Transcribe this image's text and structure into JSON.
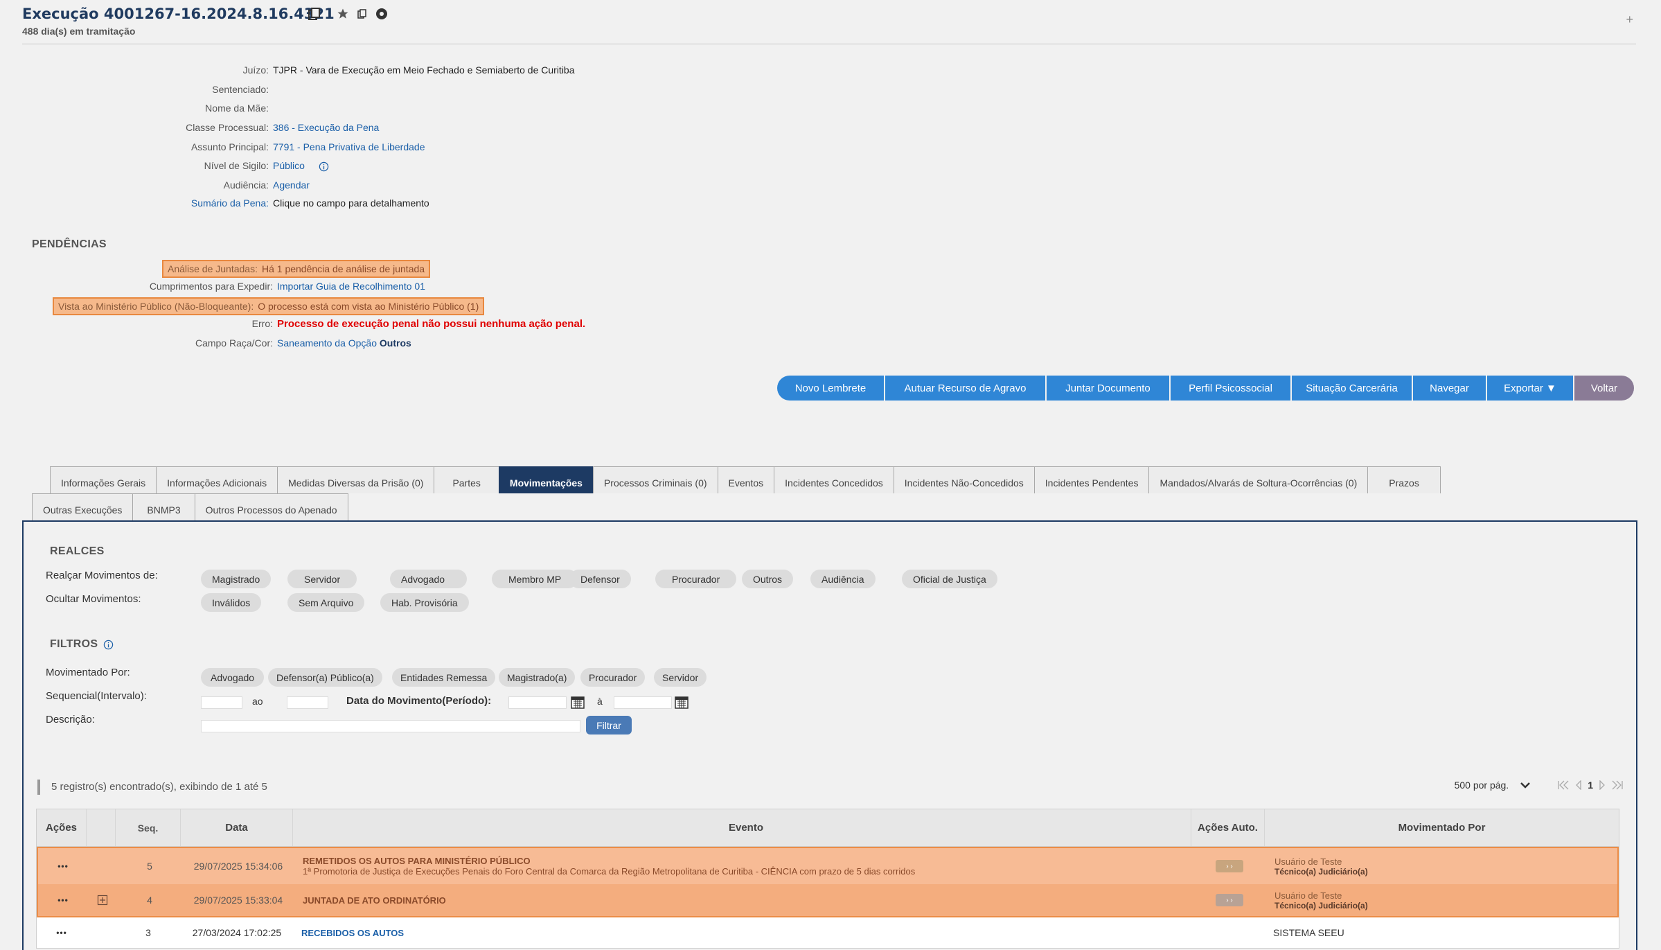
{
  "header": {
    "title": "Execução 4001267-16.2024.8.16.4321",
    "subtitle": "488 dia(s) em tramitação",
    "plus": "+"
  },
  "details": [
    {
      "label": "Juízo:",
      "value": "TJPR - Vara de Execução em Meio Fechado e Semiaberto de Curitiba"
    },
    {
      "label": "Sentenciado:",
      "value": ""
    },
    {
      "label": "Nome da Mãe:",
      "value": ""
    },
    {
      "label": "Classe Processual:",
      "value": "386 - Execução da Pena"
    },
    {
      "label": "Assunto Principal:",
      "value": "7791 - Pena Privativa de Liberdade"
    },
    {
      "label": "Nível de Sigilo:",
      "value": "Público"
    },
    {
      "label": "Audiência:",
      "value": "Agendar"
    },
    {
      "label": "Sumário da Pena:",
      "value": "Clique no campo para detalhamento"
    }
  ],
  "pendencias": {
    "title": "PENDÊNCIAS",
    "rows": [
      {
        "label": "Análise de Juntadas:",
        "value": "Há 1 pendência de análise de juntada"
      },
      {
        "label": "Cumprimentos para Expedir:",
        "value": "Importar Guia de Recolhimento 01"
      },
      {
        "label": "Vista ao Ministério Público (Não-Bloqueante):",
        "value": "O processo está com vista ao Ministério Público (1)"
      },
      {
        "label": "Erro:",
        "value": "Processo de execução penal não possui nenhuma ação penal."
      },
      {
        "label": "Campo Raça/Cor:",
        "value": "Saneamento da Opção ",
        "value_bold": "Outros"
      }
    ]
  },
  "actions": [
    "Novo Lembrete",
    "Autuar Recurso de Agravo",
    "Juntar Documento",
    "Perfil Psicossocial",
    "Situação Carcerária",
    "Navegar",
    "Exportar ▼",
    "Voltar"
  ],
  "tabs_row1": [
    "Informações Gerais",
    "Informações Adicionais",
    "Medidas Diversas da Prisão (0)",
    "Partes",
    "Movimentações",
    "Processos Criminais (0)",
    "Eventos",
    "Incidentes Concedidos",
    "Incidentes Não-Concedidos",
    "Incidentes Pendentes",
    "Mandados/Alvarás de Soltura-Ocorrências (0)",
    "Prazos"
  ],
  "tabs_row2": [
    "Outras Execuções",
    "BNMP3",
    "Outros Processos do Apenado"
  ],
  "realces": {
    "title": "REALCES",
    "realcar_label": "Realçar Movimentos de:",
    "realcar_chips": [
      "Magistrado",
      "Servidor",
      "Advogado",
      "Membro MP",
      "Defensor",
      "Procurador",
      "Outros",
      "Audiência",
      "Oficial de Justiça"
    ],
    "ocultar_label": "Ocultar Movimentos:",
    "ocultar_chips": [
      "Inválidos",
      "Sem Arquivo",
      "Hab. Provisória"
    ]
  },
  "filtros": {
    "title": "FILTROS",
    "mov_por_label": "Movimentado Por:",
    "mov_por_chips": [
      "Advogado",
      "Defensor(a) Público(a)",
      "Entidades Remessa",
      "Magistrado(a)",
      "Procurador",
      "Servidor"
    ],
    "seq_label": "Sequencial(Intervalo):",
    "ao": "ao",
    "data_label": "Data do Movimento(Período):",
    "a": "à",
    "desc_label": "Descrição:",
    "filtrar": "Filtrar"
  },
  "results": {
    "count_text": "5 registro(s) encontrado(s), exibindo de 1 até 5",
    "per_page": "500 por pág.",
    "page": "1"
  },
  "table": {
    "headers": [
      "Ações",
      "",
      "Seq.",
      "Data",
      "Evento",
      "Ações Auto.",
      "Movimentado Por"
    ],
    "rows": [
      {
        "acoes": "•••",
        "seq": "5",
        "data": "29/07/2025 15:34:06",
        "evento": "REMETIDOS OS AUTOS PARA MINISTÉRIO PÚBLICO",
        "evento_sub": "1ª Promotoria de Justiça de Execuções Penais do Foro Central da Comarca da Região Metropolitana de Curitiba - CIÊNCIA com prazo de 5 dias corridos",
        "user": "Usuário de Teste",
        "role": "Técnico(a) Judiciário(a)"
      },
      {
        "acoes": "•••",
        "seq": "4",
        "data": "29/07/2025 15:33:04",
        "evento": "JUNTADA DE ATO ORDINATÓRIO",
        "evento_sub": "",
        "user": "Usuário de Teste",
        "role": "Técnico(a) Judiciário(a)"
      },
      {
        "acoes": "•••",
        "seq": "3",
        "data": "27/03/2024 17:02:25",
        "evento": "RECEBIDOS OS AUTOS",
        "evento_sub": "",
        "user": "SISTEMA SEEU",
        "role": ""
      }
    ]
  },
  "icons": [
    "copy-icon",
    "star-icon",
    "duplicate-icon",
    "circle-icon",
    "info-icon",
    "calendar-icon",
    "chevron-down-icon",
    "first-page-icon",
    "prev-page-icon",
    "next-page-icon",
    "last-page-icon",
    "expand-icon"
  ]
}
